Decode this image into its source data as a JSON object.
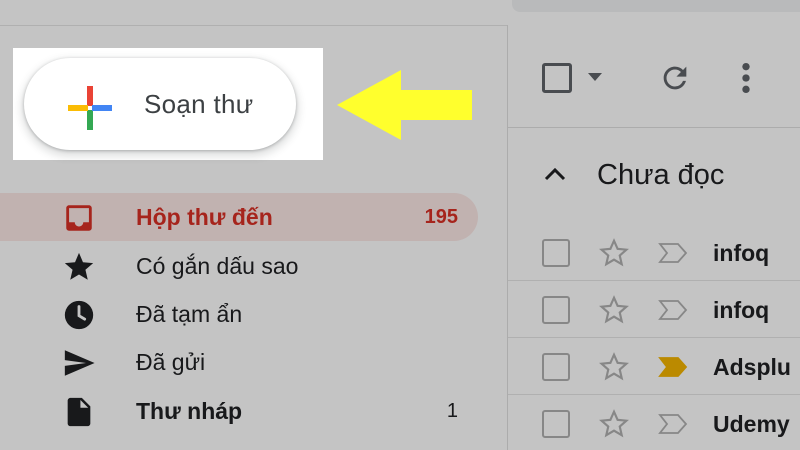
{
  "compose": {
    "label": "Soạn thư"
  },
  "sidebar": {
    "items": [
      {
        "label": "Hộp thư đến",
        "count": "195",
        "icon": "inbox-icon",
        "active": true
      },
      {
        "label": "Có gắn dấu sao",
        "count": "",
        "icon": "star-icon",
        "active": false
      },
      {
        "label": "Đã tạm ẩn",
        "count": "",
        "icon": "clock-icon",
        "active": false
      },
      {
        "label": "Đã gửi",
        "count": "",
        "icon": "send-icon",
        "active": false
      },
      {
        "label": "Thư nháp",
        "count": "1",
        "icon": "draft-icon",
        "active": false
      }
    ]
  },
  "main": {
    "section_title": "Chưa đọc",
    "rows": [
      {
        "sender": "infoq",
        "important": false
      },
      {
        "sender": "infoq",
        "important": false
      },
      {
        "sender": "Adsplu",
        "important": true
      },
      {
        "sender": "Udemy",
        "important": false
      }
    ]
  },
  "colors": {
    "accent_red": "#d93025",
    "active_bg": "#fce8e6",
    "arrow_yellow": "#ffff2d",
    "importance_yellow": "#f4b400"
  }
}
